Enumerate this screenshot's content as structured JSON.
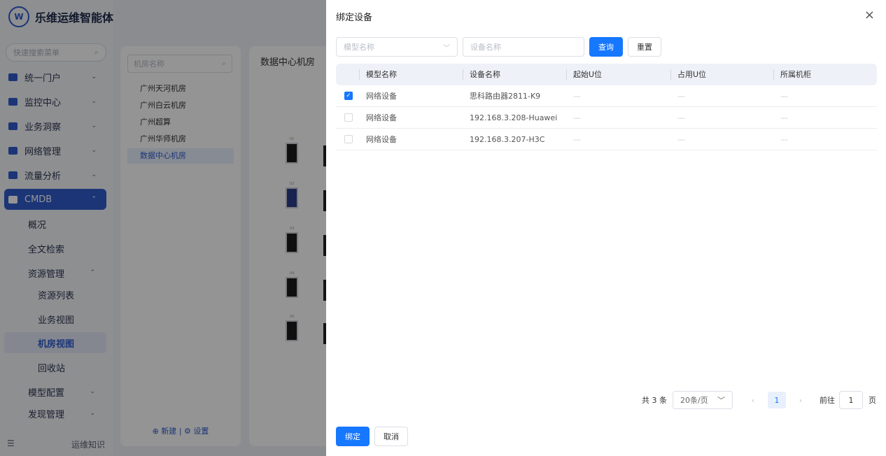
{
  "app": {
    "logo_text": "W",
    "title": "乐维运维智能体",
    "search_placeholder": "快速搜索菜单",
    "menu": [
      {
        "label": "统一门户",
        "chevron": "⌄"
      },
      {
        "label": "监控中心",
        "chevron": "⌄"
      },
      {
        "label": "业务洞察",
        "chevron": "⌄"
      },
      {
        "label": "网络管理",
        "chevron": "⌄"
      },
      {
        "label": "流量分析",
        "chevron": "⌄"
      },
      {
        "label": "CMDB",
        "chevron": "⌃"
      }
    ],
    "submenu": [
      {
        "label": "概况"
      },
      {
        "label": "全文检索"
      },
      {
        "label": "资源管理",
        "chevron": "⌃"
      },
      {
        "label": "资源列表"
      },
      {
        "label": "业务视图"
      },
      {
        "label": "机房视图"
      },
      {
        "label": "回收站"
      },
      {
        "label": "模型配置",
        "chevron": "⌄"
      },
      {
        "label": "发现管理",
        "chevron": "⌄"
      }
    ],
    "bottom_icon": "☰",
    "bottom_label": "运维知识"
  },
  "tree": {
    "search_placeholder": "机房名称",
    "rooms": [
      "广州天河机房",
      "广州白云机房",
      "广州超算",
      "广州华师机房",
      "数据中心机房"
    ],
    "new_label": "新建",
    "settings_label": "设置"
  },
  "rack": {
    "title": "数据中心机房",
    "units": [
      "U1",
      "U2",
      "U3",
      "U4",
      "U5"
    ]
  },
  "drawer": {
    "title": "绑定设备",
    "close_icon": "×",
    "model_placeholder": "模型名称",
    "device_placeholder": "设备名称",
    "query_label": "查询",
    "reset_label": "重置",
    "columns": [
      "模型名称",
      "设备名称",
      "起始U位",
      "占用U位",
      "所属机柜"
    ],
    "rows": [
      {
        "checked": true,
        "model": "网络设备",
        "device": "思科路由器2811-K9",
        "start_u": "—",
        "used_u": "—",
        "cabinet": "—"
      },
      {
        "checked": false,
        "model": "网络设备",
        "device": "192.168.3.208-Huawei",
        "start_u": "—",
        "used_u": "—",
        "cabinet": "—"
      },
      {
        "checked": false,
        "model": "网络设备",
        "device": "192.168.3.207-H3C",
        "start_u": "—",
        "used_u": "—",
        "cabinet": "—"
      }
    ],
    "pagination": {
      "total_text": "共 3 条",
      "page_size": "20条/页",
      "prev": "‹",
      "next": "›",
      "current_page": "1",
      "goto_label": "前往",
      "goto_value": "1",
      "page_suffix": "页"
    },
    "bind_label": "绑定",
    "cancel_label": "取消"
  },
  "colors": {
    "primary": "#1677ff",
    "brand": "#2f5ccd",
    "overlay": "rgba(0,0,0,0.42)"
  }
}
